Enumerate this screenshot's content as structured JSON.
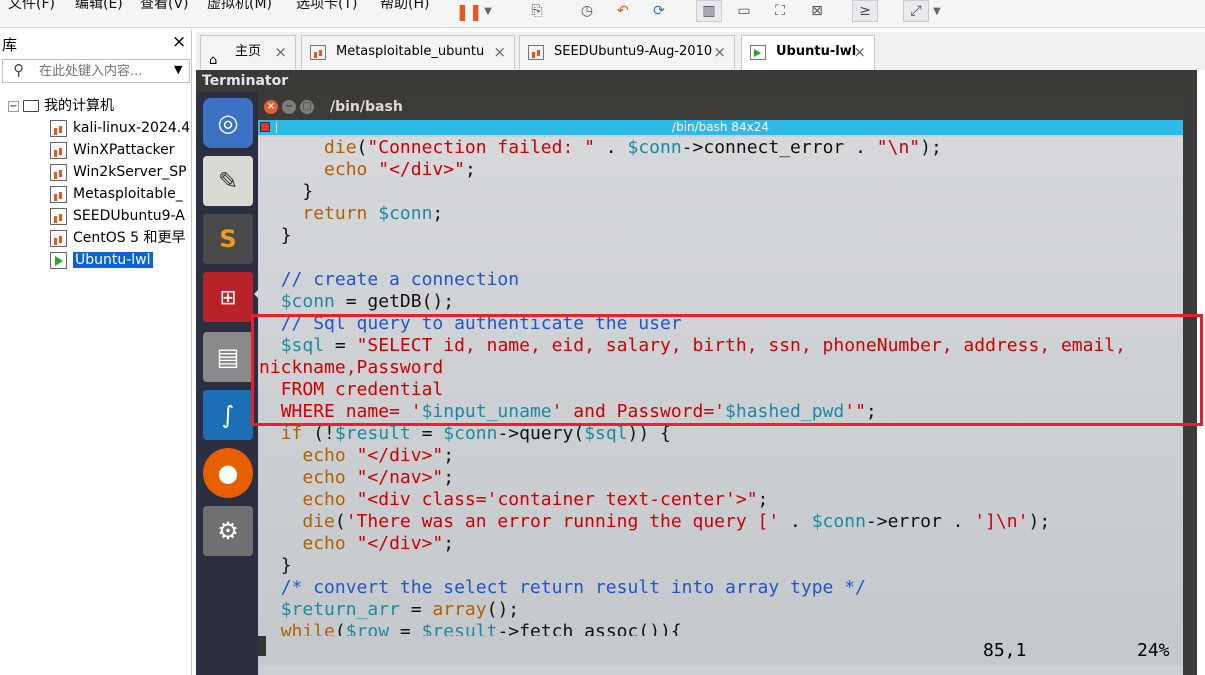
{
  "menubar": {
    "items": [
      "文件(F)",
      "编辑(E)",
      "查看(V)",
      "虚拟机(M)",
      "选项卡(T)",
      "帮助(H)"
    ]
  },
  "library": {
    "title": "库",
    "search_placeholder": "在此处键入内容...",
    "root_label": "我的计算机",
    "vms": [
      {
        "label": "kali-linux-2024.4",
        "running": false,
        "selected": false
      },
      {
        "label": "WinXPattacker",
        "running": false,
        "selected": false
      },
      {
        "label": "Win2kServer_SP",
        "running": false,
        "selected": false
      },
      {
        "label": "Metasploitable_",
        "running": false,
        "selected": false
      },
      {
        "label": "SEEDUbuntu9-A",
        "running": false,
        "selected": false
      },
      {
        "label": "CentOS 5 和更早",
        "running": false,
        "selected": false
      },
      {
        "label": "Ubuntu-lwl",
        "running": true,
        "selected": true
      }
    ]
  },
  "tabs": [
    {
      "label": "主页",
      "icon": "home-icon",
      "active": false
    },
    {
      "label": "Metasploitable_ubuntu",
      "icon": "vm-icon",
      "active": false
    },
    {
      "label": "SEEDUbuntu9-Aug-2010",
      "icon": "vm-icon",
      "active": false
    },
    {
      "label": "Ubuntu-lwl",
      "icon": "vm-running-icon",
      "active": true
    }
  ],
  "guest": {
    "app_title": "Terminator",
    "window_title": "/bin/bash",
    "vim_bar": "/bin/bash 84x24",
    "status_pos": "85,1",
    "status_pct": "24%"
  },
  "code_lines": [
    [
      [
        "      ",
        ""
      ],
      [
        "die",
        "fn"
      ],
      [
        "(",
        "p"
      ],
      [
        "\"Connection failed: \"",
        "s"
      ],
      [
        " . ",
        "p"
      ],
      [
        "$conn",
        "v"
      ],
      [
        "->",
        "p"
      ],
      [
        "connect_error",
        "t"
      ],
      [
        " . ",
        "p"
      ],
      [
        "\"\\n\"",
        "s"
      ],
      [
        ");",
        "p"
      ]
    ],
    [
      [
        "      ",
        ""
      ],
      [
        "echo",
        "fn"
      ],
      [
        " ",
        ""
      ],
      [
        "\"</div>\"",
        "s"
      ],
      [
        ";",
        "p"
      ]
    ],
    [
      [
        "    ",
        ""
      ],
      [
        "}",
        "p"
      ]
    ],
    [
      [
        "    ",
        ""
      ],
      [
        "return",
        "fn"
      ],
      [
        " ",
        ""
      ],
      [
        "$conn",
        "v"
      ],
      [
        ";",
        "p"
      ]
    ],
    [
      [
        "  ",
        ""
      ],
      [
        "}",
        "p"
      ]
    ],
    [
      [
        "",
        ""
      ]
    ],
    [
      [
        "  ",
        ""
      ],
      [
        "// create a connection",
        "c"
      ]
    ],
    [
      [
        "  ",
        ""
      ],
      [
        "$conn",
        "v"
      ],
      [
        " = ",
        "p"
      ],
      [
        "getDB",
        "t"
      ],
      [
        "()",
        "p"
      ],
      [
        ";",
        "p"
      ]
    ],
    [
      [
        "  ",
        ""
      ],
      [
        "// Sql query to authenticate the user",
        "c"
      ]
    ],
    [
      [
        "  ",
        ""
      ],
      [
        "$sql",
        "v"
      ],
      [
        " = ",
        "p"
      ],
      [
        "\"SELECT id, name, eid, salary, birth, ssn, phoneNumber, address, email,",
        "s"
      ]
    ],
    [
      [
        "nickname,Password",
        "s"
      ]
    ],
    [
      [
        "  ",
        ""
      ],
      [
        "FROM credential",
        "s"
      ]
    ],
    [
      [
        "  ",
        ""
      ],
      [
        "WHERE name= '",
        "s"
      ],
      [
        "$input_uname",
        "v"
      ],
      [
        "' and Password='",
        "s"
      ],
      [
        "$hashed_pwd",
        "v"
      ],
      [
        "'\"",
        "s"
      ],
      [
        ";",
        "p"
      ]
    ],
    [
      [
        "  ",
        ""
      ],
      [
        "if",
        "fn"
      ],
      [
        " (!",
        "p"
      ],
      [
        "$result",
        "v"
      ],
      [
        " = ",
        "p"
      ],
      [
        "$conn",
        "v"
      ],
      [
        "->",
        "p"
      ],
      [
        "query",
        "t"
      ],
      [
        "(",
        "p"
      ],
      [
        "$sql",
        "v"
      ],
      [
        ")) {",
        "p"
      ]
    ],
    [
      [
        "    ",
        ""
      ],
      [
        "echo",
        "fn"
      ],
      [
        " ",
        ""
      ],
      [
        "\"</div>\"",
        "s"
      ],
      [
        ";",
        "p"
      ]
    ],
    [
      [
        "    ",
        ""
      ],
      [
        "echo",
        "fn"
      ],
      [
        " ",
        ""
      ],
      [
        "\"</nav>\"",
        "s"
      ],
      [
        ";",
        "p"
      ]
    ],
    [
      [
        "    ",
        ""
      ],
      [
        "echo",
        "fn"
      ],
      [
        " ",
        ""
      ],
      [
        "\"<div class='container text-center'>\"",
        "s"
      ],
      [
        ";",
        "p"
      ]
    ],
    [
      [
        "    ",
        ""
      ],
      [
        "die",
        "fn"
      ],
      [
        "(",
        "p"
      ],
      [
        "'There was an error running the query ['",
        "s"
      ],
      [
        " . ",
        "p"
      ],
      [
        "$conn",
        "v"
      ],
      [
        "->",
        "p"
      ],
      [
        "error",
        "t"
      ],
      [
        " . ",
        "p"
      ],
      [
        "']\\n'",
        "s"
      ],
      [
        ");",
        "p"
      ]
    ],
    [
      [
        "    ",
        ""
      ],
      [
        "echo",
        "fn"
      ],
      [
        " ",
        ""
      ],
      [
        "\"</div>\"",
        "s"
      ],
      [
        ";",
        "p"
      ]
    ],
    [
      [
        "  ",
        ""
      ],
      [
        "}",
        "p"
      ]
    ],
    [
      [
        "  ",
        ""
      ],
      [
        "/* convert the select return result into array type */",
        "c"
      ]
    ],
    [
      [
        "  ",
        ""
      ],
      [
        "$return_arr",
        "v"
      ],
      [
        " = ",
        "p"
      ],
      [
        "array",
        "fn"
      ],
      [
        "()",
        "p"
      ],
      [
        ";",
        "p"
      ]
    ],
    [
      [
        "  ",
        ""
      ],
      [
        "while",
        "fn"
      ],
      [
        "(",
        "p"
      ],
      [
        "$row",
        "v"
      ],
      [
        " = ",
        "p"
      ],
      [
        "$result",
        "v"
      ],
      [
        "->",
        "p"
      ],
      [
        "fetch_assoc",
        "t"
      ],
      [
        "()){",
        "p"
      ]
    ]
  ],
  "syntax_colors": {
    "fn": "#af5f00",
    "s": "#cc0000",
    "c": "#2255c8",
    "v": "#1a8aa0",
    "t": "#111111",
    "p": "#111111"
  },
  "highlight_color": "#e8202a"
}
